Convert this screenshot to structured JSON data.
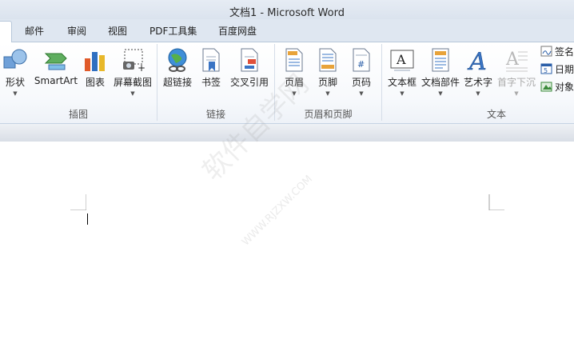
{
  "window": {
    "title": "文档1  -  Microsoft Word"
  },
  "tabs": [
    "邮件",
    "审阅",
    "视图",
    "PDF工具集",
    "百度网盘"
  ],
  "ribbon": {
    "insert_illustrations": {
      "label": "插图",
      "buttons": [
        {
          "label": "形状",
          "icon": "shapes-icon"
        },
        {
          "label": "SmartArt",
          "icon": "smartart-icon"
        },
        {
          "label": "图表",
          "icon": "chart-icon"
        },
        {
          "label": "屏幕截图",
          "icon": "screenshot-icon"
        }
      ]
    },
    "links": {
      "label": "链接",
      "buttons": [
        {
          "label": "超链接",
          "icon": "hyperlink-icon"
        },
        {
          "label": "书签",
          "icon": "bookmark-icon"
        },
        {
          "label": "交叉引用",
          "icon": "cross-reference-icon"
        }
      ]
    },
    "header_footer": {
      "label": "页眉和页脚",
      "buttons": [
        {
          "label": "页眉",
          "icon": "header-icon"
        },
        {
          "label": "页脚",
          "icon": "footer-icon"
        },
        {
          "label": "页码",
          "icon": "page-number-icon"
        }
      ]
    },
    "text": {
      "label": "文本",
      "buttons": [
        {
          "label": "文本框",
          "icon": "textbox-icon"
        },
        {
          "label": "文档部件",
          "icon": "quick-parts-icon"
        },
        {
          "label": "艺术字",
          "icon": "wordart-icon"
        },
        {
          "label": "首字下沉",
          "icon": "drop-cap-icon"
        }
      ],
      "small_buttons": [
        {
          "label": "签名",
          "icon": "signature-icon"
        },
        {
          "label": "日期",
          "icon": "date-time-icon"
        },
        {
          "label": "对象",
          "icon": "object-icon"
        }
      ]
    }
  },
  "watermark": {
    "line1": "软件自学网",
    "line2": "WWW.RJZXW.COM"
  },
  "colors": {
    "tab_bar": "#dfe7f1",
    "ribbon": "#f7f9fc",
    "accent": "#2a5ea8"
  }
}
